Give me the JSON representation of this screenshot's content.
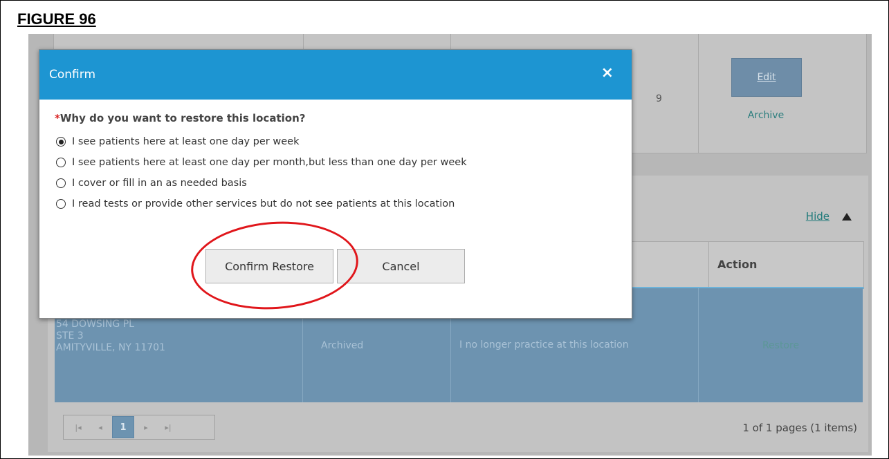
{
  "figure": {
    "title": "FIGURE 96"
  },
  "background": {
    "top_card": {
      "edit_label": "Edit",
      "archive_label": "Archive",
      "partial_text": "9"
    },
    "panel": {
      "hide_label": "Hide",
      "table": {
        "header_action": "Action",
        "row": {
          "address": [
            "54 DOWSING PL",
            "STE 3",
            "AMITYVILLE, NY 11701"
          ],
          "status": "Archived",
          "reason": "I no longer practice at this location",
          "action": "Restore"
        }
      },
      "pager": {
        "buttons": [
          "|◂",
          "◂",
          "1",
          "▸",
          "▸|"
        ],
        "current_page": 1,
        "info": "1 of 1 pages (1 items)"
      }
    }
  },
  "modal": {
    "title": "Confirm",
    "close": "×",
    "required_marker": "*",
    "question": "Why do you want to restore this location?",
    "options": [
      {
        "label": "I see patients here at least one day per week",
        "selected": true
      },
      {
        "label": "I see patients here at least one day per month,but less than one day per week",
        "selected": false
      },
      {
        "label": "I cover or fill in an as needed basis",
        "selected": false
      },
      {
        "label": "I read tests or provide other services but do not see patients at this location",
        "selected": false
      }
    ],
    "confirm_label": "Confirm Restore",
    "cancel_label": "Cancel"
  },
  "colors": {
    "modal_header": "#1d95d2",
    "annotation": "#e0161b",
    "selected_row": "#6d93b0"
  }
}
